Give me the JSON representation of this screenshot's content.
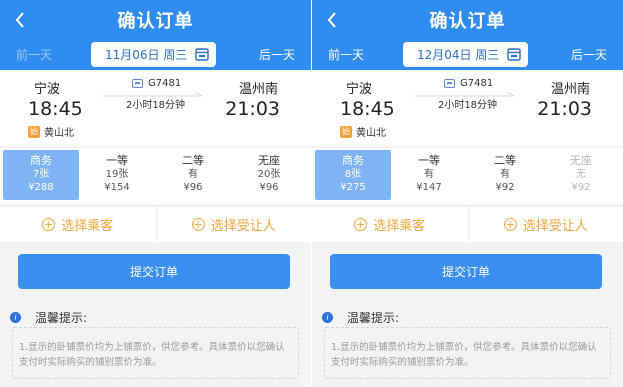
{
  "screens": [
    {
      "header": {
        "title": "确认订单",
        "prev_day": "前一天",
        "next_day": "后一天",
        "date": "11月06日 周三"
      },
      "trip": {
        "from_station": "宁波",
        "from_time": "18:45",
        "via_badge": "始",
        "via_station": "黄山北",
        "train_no": "G7481",
        "duration": "2小时18分钟",
        "to_station": "温州南",
        "to_time": "21:03"
      },
      "seats": [
        {
          "name": "商务",
          "count": "7张",
          "price": "¥288"
        },
        {
          "name": "一等",
          "count": "19张",
          "price": "¥154"
        },
        {
          "name": "二等",
          "count": "有",
          "price": "¥96"
        },
        {
          "name": "无座",
          "count": "20张",
          "price": "¥96"
        }
      ],
      "actions": {
        "choose_passenger": "选择乘客",
        "choose_beneficiary": "选择受让人",
        "submit": "提交订单"
      },
      "tips": {
        "title": "温馨提示:",
        "text": "1.显示的卧铺票价均为上铺票价，供您参考。具体票价以您确认支付时实际购买的铺别票价为准。"
      }
    },
    {
      "header": {
        "title": "确认订单",
        "prev_day": "前一天",
        "next_day": "后一天",
        "date": "12月04日 周三"
      },
      "trip": {
        "from_station": "宁波",
        "from_time": "18:45",
        "via_badge": "始",
        "via_station": "黄山北",
        "train_no": "G7481",
        "duration": "2小时18分钟",
        "to_station": "温州南",
        "to_time": "21:03"
      },
      "seats": [
        {
          "name": "商务",
          "count": "8张",
          "price": "¥275"
        },
        {
          "name": "一等",
          "count": "有",
          "price": "¥147"
        },
        {
          "name": "二等",
          "count": "有",
          "price": "¥92"
        },
        {
          "name": "无座",
          "count": "无",
          "price": "¥92"
        }
      ],
      "actions": {
        "choose_passenger": "选择乘客",
        "choose_beneficiary": "选择受让人",
        "submit": "提交订单"
      },
      "tips": {
        "title": "温馨提示:",
        "text": "1.显示的卧铺票价均为上铺票价，供您参考。具体票价以您确认支付时实际购买的铺别票价为准。"
      }
    }
  ],
  "colors": {
    "header_blue": "#2f8cf1",
    "selected_seat": "#7eb4f3",
    "accent_orange": "#f0a43c",
    "submit_blue": "#3a8ef0"
  },
  "icons": {
    "back": "back-arrow-icon",
    "calendar": "calendar-icon",
    "train": "train-icon",
    "add": "plus-circle-icon",
    "info": "info-icon"
  }
}
